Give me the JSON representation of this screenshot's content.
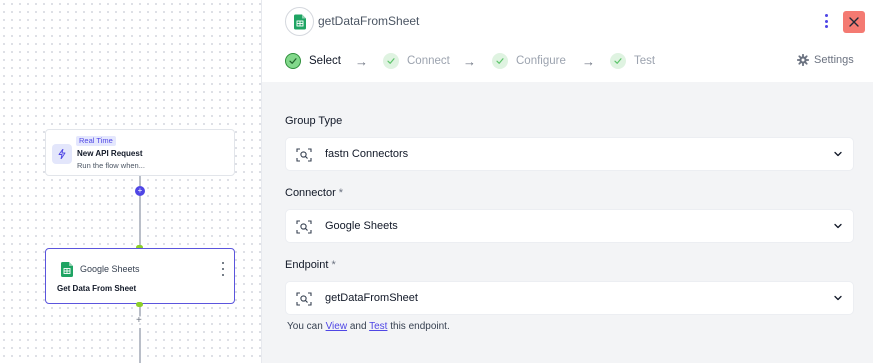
{
  "canvas": {
    "trigger_node": {
      "badge": "Real Time",
      "title": "New API Request",
      "subtitle": "Run the flow when..."
    },
    "add_step_symbol": "+",
    "action_node": {
      "app_name": "Google Sheets",
      "action": "Get Data From Sheet"
    },
    "below_plus": "+"
  },
  "panel": {
    "title": "getDataFromSheet",
    "steps": [
      {
        "label": "Select",
        "state": "active"
      },
      {
        "label": "Connect",
        "state": "pending"
      },
      {
        "label": "Configure",
        "state": "pending"
      },
      {
        "label": "Test",
        "state": "pending"
      }
    ],
    "settings_label": "Settings",
    "fields": [
      {
        "label": "Group Type",
        "required": false,
        "value": "fastn Connectors"
      },
      {
        "label": "Connector",
        "required": true,
        "value": "Google Sheets"
      },
      {
        "label": "Endpoint",
        "required": true,
        "value": "getDataFromSheet"
      }
    ],
    "required_mark": "*",
    "hint": {
      "prefix": "You can ",
      "view_link": "View",
      "middle": " and ",
      "test_link": "Test",
      "suffix": " this endpoint."
    }
  },
  "colors": {
    "accent": "#4f46e5",
    "close_button": "#f47a72",
    "step_done": "#82d88b",
    "sheets_green": "#1fa463",
    "connector_green": "#8ccf2b"
  }
}
